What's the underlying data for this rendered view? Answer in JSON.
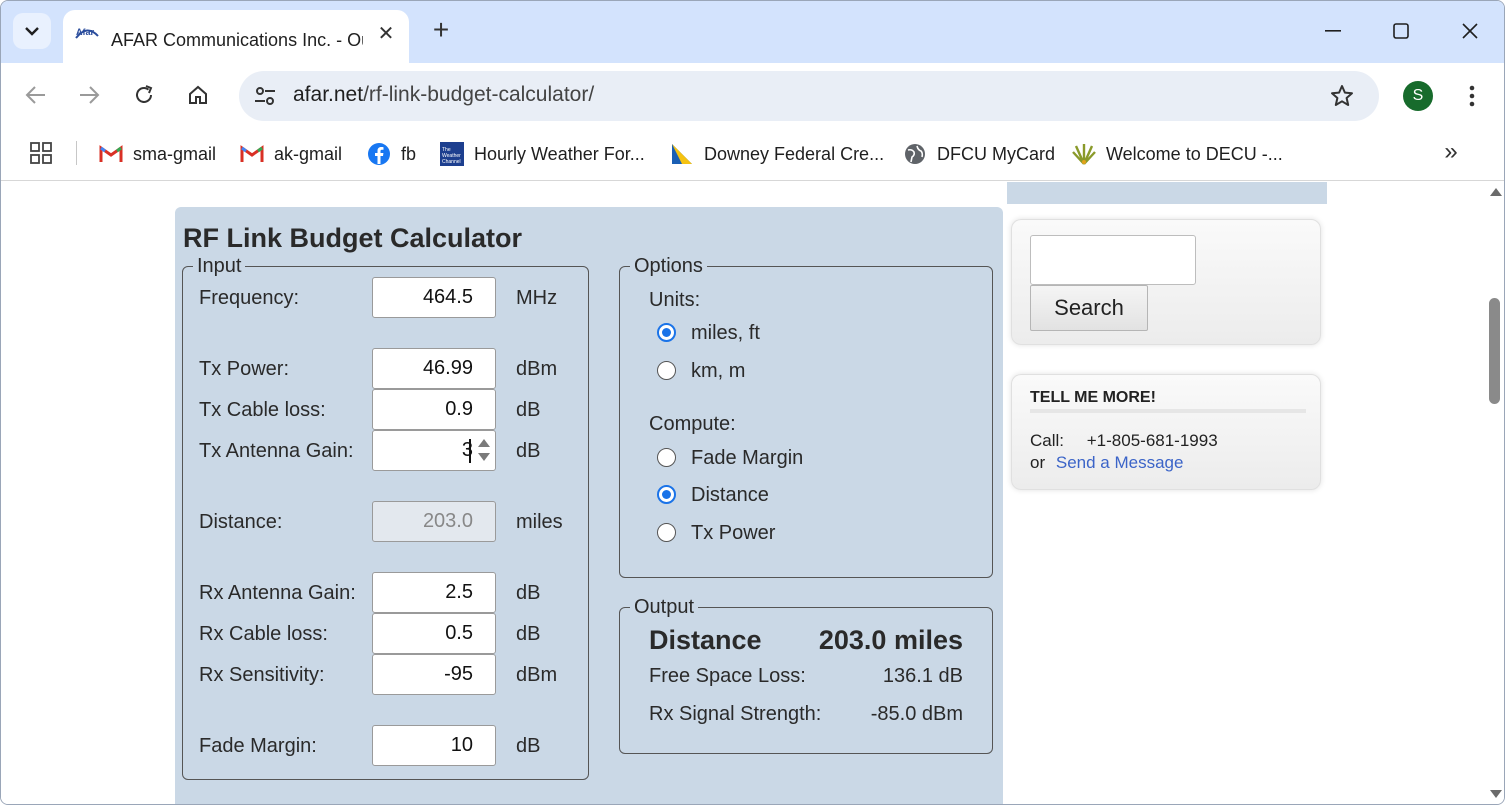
{
  "browser": {
    "tab": {
      "title": "AFAR Communications Inc. - Ou",
      "favicon_text": "Afar"
    },
    "url": {
      "host": "afar.net",
      "path": "/rf-link-budget-calculator/"
    },
    "profile_initial": "S",
    "bookmarks": [
      {
        "label": "sma-gmail",
        "icon": "gmail-icon"
      },
      {
        "label": "ak-gmail",
        "icon": "gmail-icon"
      },
      {
        "label": "fb",
        "icon": "facebook-icon"
      },
      {
        "label": "Hourly Weather For...",
        "icon": "weather-channel-icon",
        "icon_text": "The Weather Channel"
      },
      {
        "label": "Downey Federal Cre...",
        "icon": "downey-federal-icon"
      },
      {
        "label": "DFCU MyCard",
        "icon": "globe-icon"
      },
      {
        "label": "Welcome to DECU -...",
        "icon": "decu-icon"
      }
    ]
  },
  "calculator": {
    "title": "RF Link Budget Calculator",
    "input": {
      "legend": "Input",
      "fields": [
        {
          "label": "Frequency:",
          "value": "464.5",
          "unit": "MHz"
        },
        {
          "label": "Tx Power:",
          "value": "46.99",
          "unit": "dBm"
        },
        {
          "label": "Tx Cable loss:",
          "value": "0.9",
          "unit": "dB"
        },
        {
          "label": "Tx Antenna Gain:",
          "value": "3",
          "unit": "dB"
        },
        {
          "label": "Distance:",
          "value": "203.0",
          "unit": "miles"
        },
        {
          "label": "Rx Antenna Gain:",
          "value": "2.5",
          "unit": "dB"
        },
        {
          "label": "Rx Cable loss:",
          "value": "0.5",
          "unit": "dB"
        },
        {
          "label": "Rx Sensitivity:",
          "value": "-95",
          "unit": "dBm"
        },
        {
          "label": "Fade Margin:",
          "value": "10",
          "unit": "dB"
        }
      ]
    },
    "options": {
      "legend": "Options",
      "units_label": "Units:",
      "units": [
        {
          "label": "miles, ft",
          "checked": true
        },
        {
          "label": "km, m",
          "checked": false
        }
      ],
      "compute_label": "Compute:",
      "compute": [
        {
          "label": "Fade Margin",
          "checked": false
        },
        {
          "label": "Distance",
          "checked": true
        },
        {
          "label": "Tx Power",
          "checked": false
        }
      ]
    },
    "output": {
      "legend": "Output",
      "headline_label": "Distance",
      "headline_value": "203.0 miles",
      "rows": [
        {
          "label": "Free Space Loss:",
          "value": "136.1 dB"
        },
        {
          "label": "Rx Signal Strength:",
          "value": "-85.0 dBm"
        }
      ]
    }
  },
  "sidebar": {
    "search_button": "Search",
    "tell_me_more": {
      "heading": "TELL ME MORE!",
      "call_label": "Call:",
      "phone": "+1-805-681-1993",
      "or_label": "or",
      "link": "Send a Message"
    }
  },
  "colors": {
    "panel": "#cad8e6",
    "tab_strip": "#d3e3fd",
    "radio_accent": "#1a73e8",
    "link": "#3b64c8"
  }
}
